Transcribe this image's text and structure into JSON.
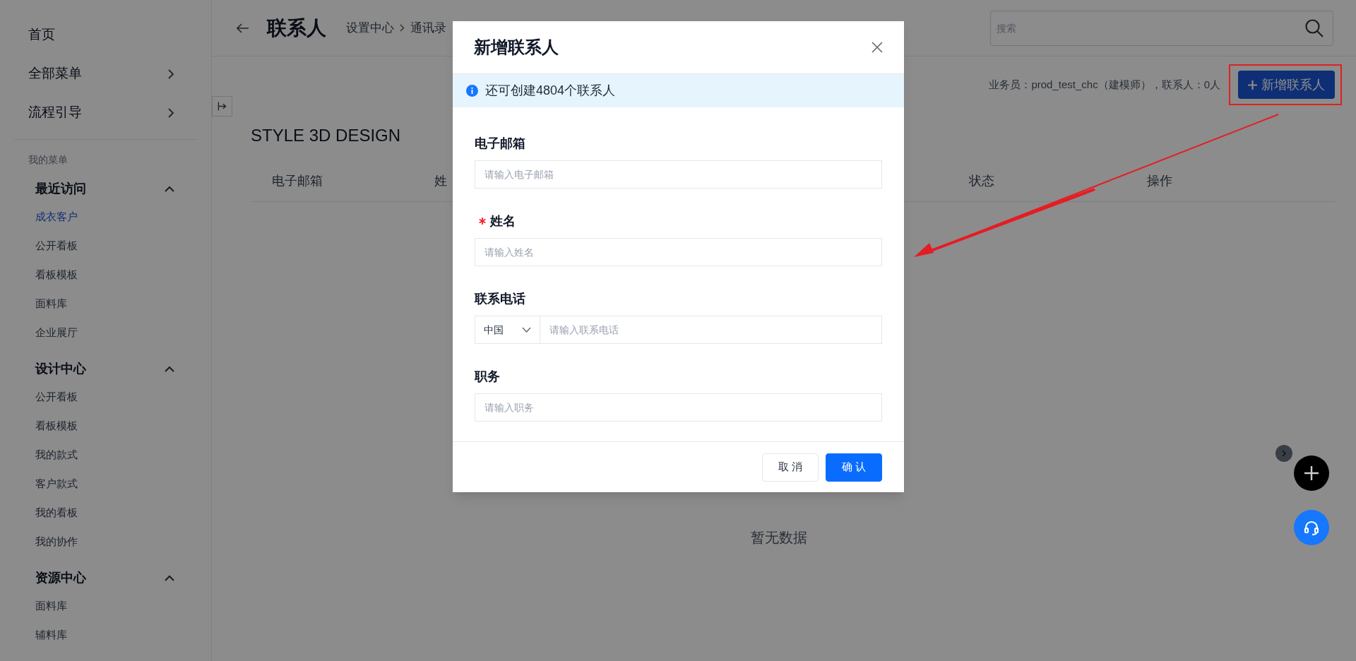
{
  "sidebar": {
    "top_items": [
      {
        "label": "首页",
        "has_arrow": false
      },
      {
        "label": "全部菜单",
        "has_arrow": true
      },
      {
        "label": "流程引导",
        "has_arrow": true
      }
    ],
    "my_menu_label": "我的菜单",
    "groups": [
      {
        "title": "最近访问",
        "expanded": true,
        "items": [
          {
            "label": "成衣客户",
            "selected": true
          },
          {
            "label": "公开看板",
            "selected": false
          },
          {
            "label": "看板模板",
            "selected": false
          },
          {
            "label": "面料库",
            "selected": false
          },
          {
            "label": "企业展厅",
            "selected": false
          }
        ]
      },
      {
        "title": "设计中心",
        "expanded": true,
        "items": [
          {
            "label": "公开看板",
            "selected": false
          },
          {
            "label": "看板模板",
            "selected": false
          },
          {
            "label": "我的款式",
            "selected": false
          },
          {
            "label": "客户款式",
            "selected": false
          },
          {
            "label": "我的看板",
            "selected": false
          },
          {
            "label": "我的协作",
            "selected": false
          }
        ]
      },
      {
        "title": "资源中心",
        "expanded": true,
        "items": [
          {
            "label": "面料库",
            "selected": false
          },
          {
            "label": "辅料库",
            "selected": false
          }
        ]
      }
    ]
  },
  "header": {
    "title": "联系人",
    "breadcrumb": [
      "设置中心",
      "通讯录"
    ],
    "search": {
      "placeholder": "搜索"
    }
  },
  "toolbar": {
    "summary": "业务员：prod_test_chc（建模师），联系人：0人",
    "add_button": "新增联系人"
  },
  "section_title": "STYLE 3D DESIGN",
  "table": {
    "columns": [
      "电子邮箱",
      "姓",
      "状态",
      "操作"
    ],
    "empty_text": "暂无数据"
  },
  "modal": {
    "title": "新增联系人",
    "info": "还可创建4804个联系人",
    "fields": [
      {
        "kind": "text",
        "label": "电子邮箱",
        "required": false,
        "placeholder": "请输入电子邮箱"
      },
      {
        "kind": "text",
        "label": "姓名",
        "required": true,
        "placeholder": "请输入姓名"
      },
      {
        "kind": "phone",
        "label": "联系电话",
        "required": false,
        "country": "中国",
        "placeholder": "请输入联系电话"
      },
      {
        "kind": "text",
        "label": "职务",
        "required": false,
        "placeholder": "请输入职务"
      }
    ],
    "buttons": [
      {
        "label": "取 消",
        "kind": "secondary"
      },
      {
        "label": "确 认",
        "kind": "primary"
      }
    ]
  }
}
